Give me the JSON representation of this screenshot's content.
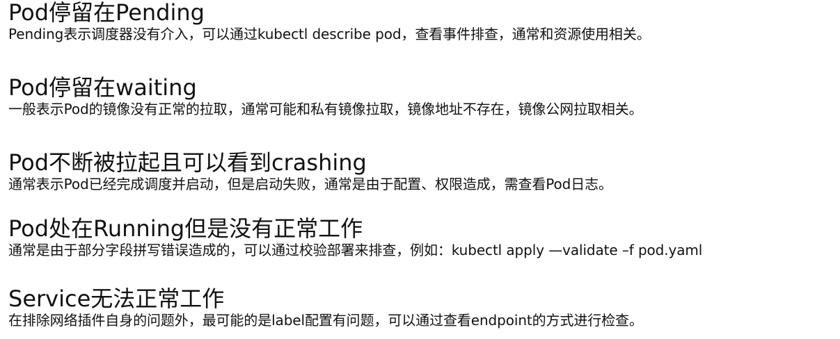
{
  "sections": [
    {
      "heading": "Pod停留在Pending",
      "text": "Pending表示调度器没有介入，可以通过kubectl describe pod，查看事件排查，通常和资源使用相关。"
    },
    {
      "heading": "Pod停留在waiting",
      "text": "一般表示Pod的镜像没有正常的拉取，通常可能和私有镜像拉取，镜像地址不存在，镜像公网拉取相关。"
    },
    {
      "heading": "Pod不断被拉起且可以看到crashing",
      "text": "通常表示Pod已经完成调度并启动，但是启动失败，通常是由于配置、权限造成，需查看Pod日志。"
    },
    {
      "heading": "Pod处在Running但是没有正常工作",
      "text": "通常是由于部分字段拼写错误造成的，可以通过校验部署来排查，例如：kubectl apply —validate –f pod.yaml"
    },
    {
      "heading": "Service无法正常工作",
      "text": "在排除网络插件自身的问题外，最可能的是label配置有问题，可以通过查看endpoint的方式进行检查。"
    }
  ]
}
